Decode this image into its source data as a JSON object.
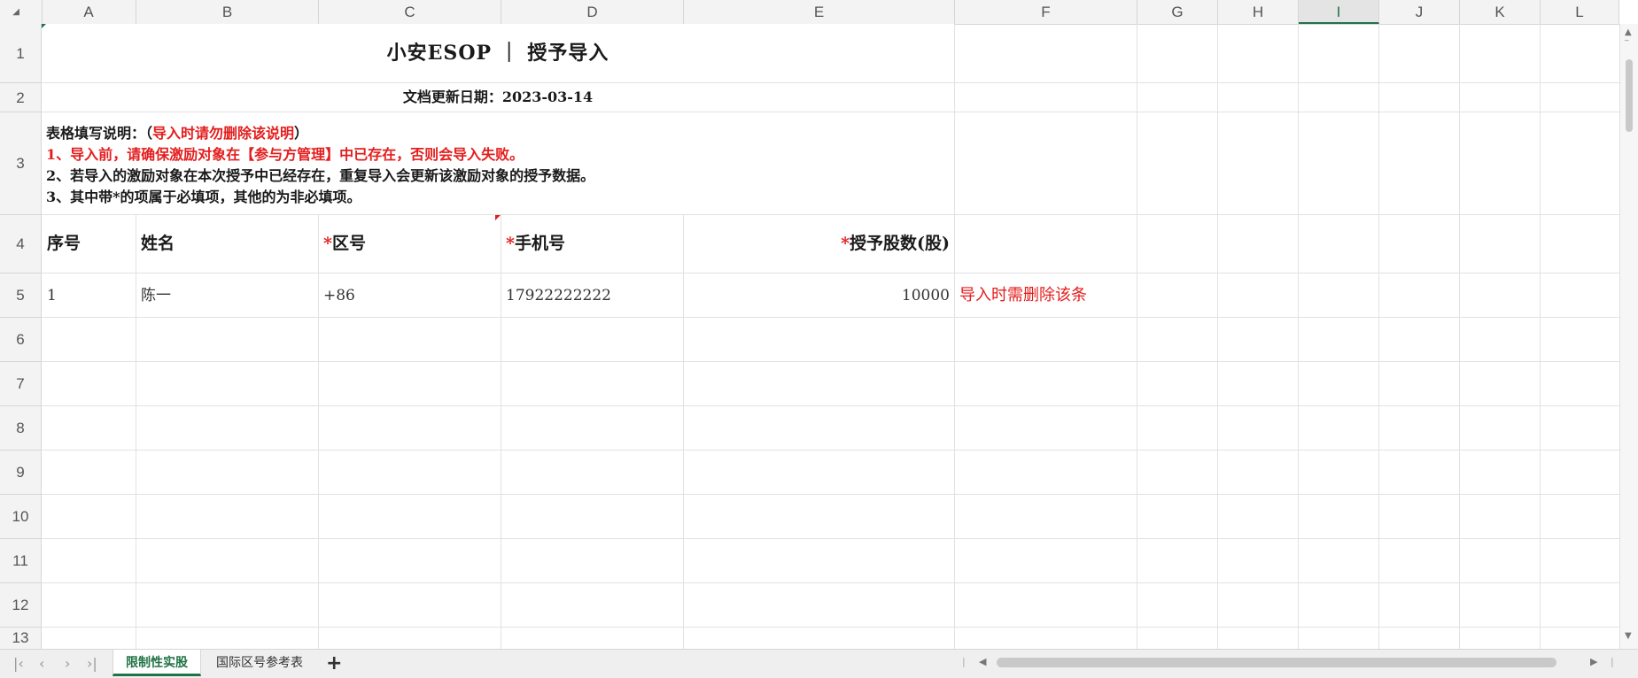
{
  "columns": [
    "A",
    "B",
    "C",
    "D",
    "E",
    "F",
    "G",
    "H",
    "I",
    "J",
    "K",
    "L"
  ],
  "selected_column": "I",
  "rows": [
    "1",
    "2",
    "3",
    "4",
    "5",
    "6",
    "7",
    "8",
    "9",
    "10",
    "11",
    "12",
    "13"
  ],
  "corner_symbol": "◢",
  "title": "小安ESOP ｜ 授予导入",
  "update_date": "文档更新日期：2023-03-14",
  "notes": {
    "line1_black": "表格填写说明：（",
    "line1_red": "导入时请勿删除该说明",
    "line1_end": "）",
    "line2": "1、导入前，请确保激励对象在【参与方管理】中已存在，否则会导入失败。",
    "line3": "2、若导入的激励对象在本次授予中已经存在，重复导入会更新该激励对象的授予数据。",
    "line4": "3、其中带*的项属于必填项，其他的为非必填项。"
  },
  "headers": {
    "seq": "序号",
    "name": "姓名",
    "required_mark": "*",
    "area_code": "区号",
    "phone": "手机号",
    "shares": "授予股数(股)"
  },
  "sample_row": {
    "seq": "1",
    "name": "陈一",
    "area_code": "+86",
    "phone": "17922222222",
    "shares": "10000",
    "note": "导入时需删除该条"
  },
  "sheet_tabs": {
    "active": "限制性实股",
    "other": "国际区号参考表",
    "add": "+"
  },
  "nav_icons": [
    "first-sheet-icon",
    "prev-sheet-icon",
    "next-sheet-icon",
    "last-sheet-icon"
  ],
  "colors": {
    "accent": "#217346",
    "required_red": "#e41d1d"
  }
}
